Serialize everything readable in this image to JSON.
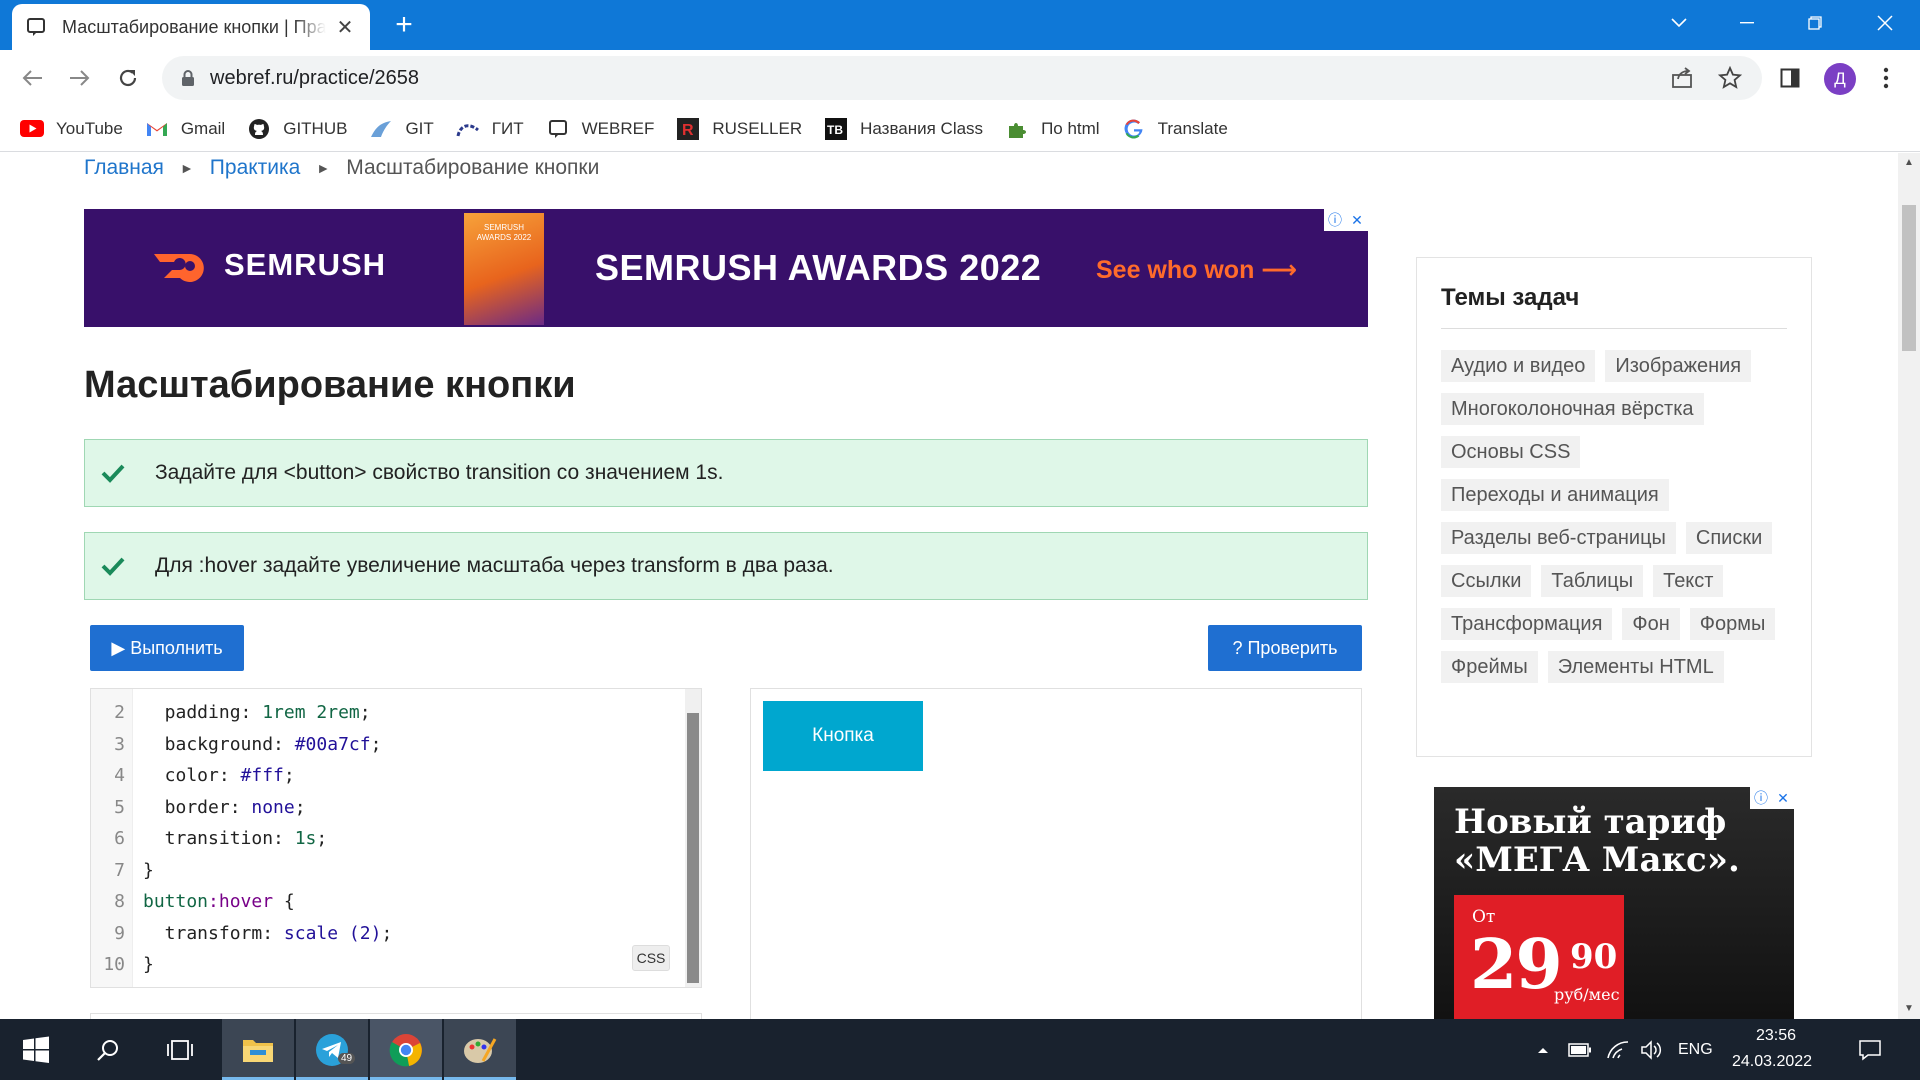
{
  "browser": {
    "tab_title": "Масштабирование кнопки | Практика",
    "url": "webref.ru/practice/2658",
    "profile_initial": "Д"
  },
  "bookmarks": [
    {
      "label": "YouTube",
      "icon": "youtube-icon"
    },
    {
      "label": "Gmail",
      "icon": "gmail-icon"
    },
    {
      "label": "GITHUB",
      "icon": "github-icon"
    },
    {
      "label": "GIT",
      "icon": "git-icon"
    },
    {
      "label": "ГИТ",
      "icon": "git-alt-icon"
    },
    {
      "label": "WEBREF",
      "icon": "webref-icon"
    },
    {
      "label": "RUSELLER",
      "icon": "ruseller-icon"
    },
    {
      "label": "Названия Class",
      "icon": "tb-icon"
    },
    {
      "label": "По html",
      "icon": "puzzle-icon"
    },
    {
      "label": "Translate",
      "icon": "google-icon"
    }
  ],
  "breadcrumb": {
    "home": "Главная",
    "practice": "Практика",
    "current": "Масштабирование кнопки"
  },
  "ad_banner": {
    "logo": "SEMRUSH",
    "trophy_text": "SEMRUSH AWARDS 2022",
    "headline": "SEMRUSH AWARDS 2022",
    "cta": "See who won ⟶"
  },
  "page_title": "Масштабирование кнопки",
  "tasks": [
    "Задайте для <button> свойство transition со значением 1s.",
    "Для :hover задайте увеличение масштаба через transform в два раза."
  ],
  "buttons": {
    "run": "▶ Выполнить",
    "check": "? Проверить"
  },
  "code": {
    "lang_label": "CSS",
    "lines": [
      {
        "n": "2",
        "text": "  padding: 1rem 2rem;"
      },
      {
        "n": "3",
        "text": "  background: #00a7cf;"
      },
      {
        "n": "4",
        "text": "  color: #fff;"
      },
      {
        "n": "5",
        "text": "  border: none;"
      },
      {
        "n": "6",
        "text": "  transition: 1s;"
      },
      {
        "n": "7",
        "text": "}"
      },
      {
        "n": "8",
        "text": "button:hover {"
      },
      {
        "n": "9",
        "text": "  transform: scale (2);"
      },
      {
        "n": "10",
        "text": "}"
      }
    ]
  },
  "preview": {
    "button_label": "Кнопка"
  },
  "sidebar": {
    "title": "Темы задач",
    "tags": [
      "Аудио и видео",
      "Изображения",
      "Многоколоночная вёрстка",
      "Основы CSS",
      "Переходы и анимация",
      "Разделы веб-страницы",
      "Списки",
      "Ссылки",
      "Таблицы",
      "Текст",
      "Трансформация",
      "Фон",
      "Формы",
      "Фреймы",
      "Элементы HTML"
    ]
  },
  "ad_tariff": {
    "line1": "Новый тариф",
    "line2": "«МЕГА Макс».",
    "from": "От",
    "price_int": "29",
    "price_frac": "90",
    "unit": "руб/мес"
  },
  "taskbar": {
    "telegram_badge": "49",
    "lang": "ENG",
    "time": "23:56",
    "date": "24.03.2022"
  },
  "colors": {
    "tabstrip": "#0f78d7",
    "accent_button": "#1f6fd1",
    "demo_button": "#00a7cf",
    "task_bg": "#dff7e8",
    "ad_bg": "#38106a"
  }
}
